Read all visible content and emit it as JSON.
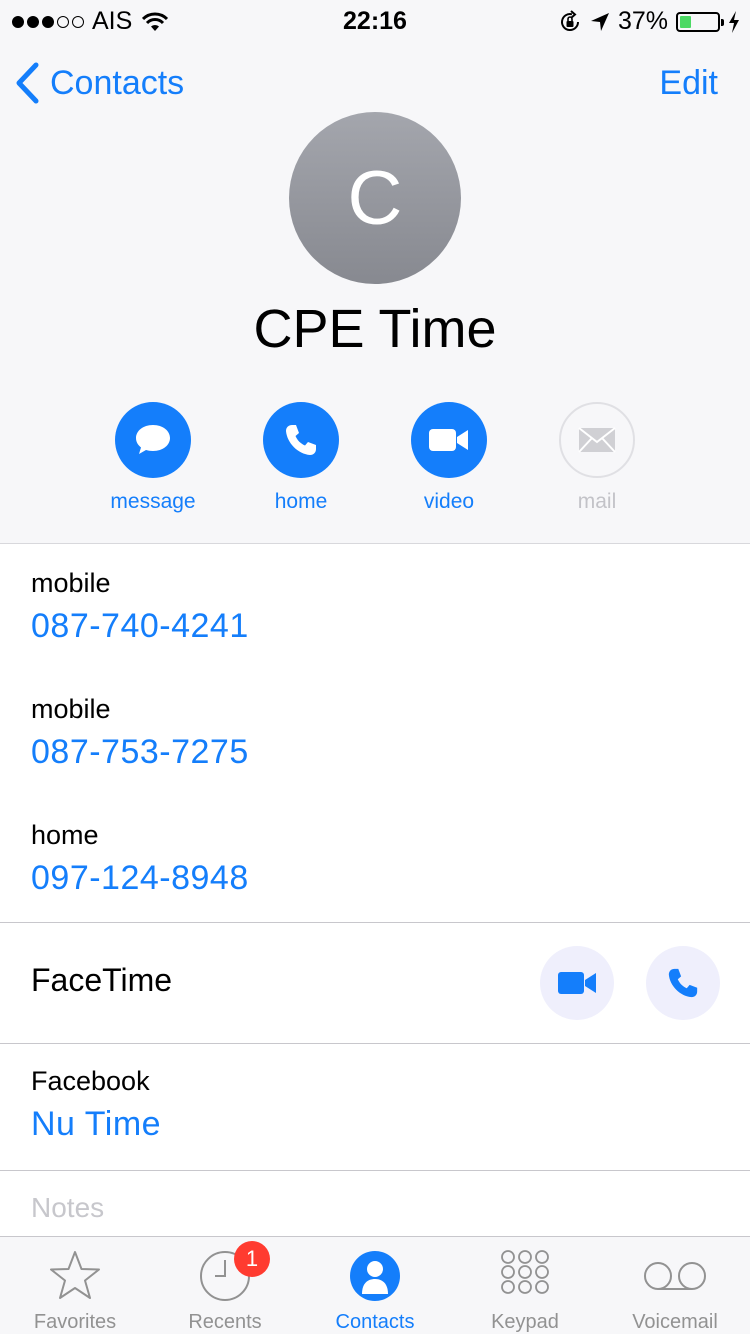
{
  "status_bar": {
    "carrier": "AIS",
    "time": "22:16",
    "battery": "37%",
    "battery_level": 0.37
  },
  "nav": {
    "back_label": "Contacts",
    "edit_label": "Edit"
  },
  "contact": {
    "initial": "C",
    "name": "CPE Time"
  },
  "actions": [
    {
      "label": "message",
      "icon": "message-bubble-icon",
      "enabled": true
    },
    {
      "label": "home",
      "icon": "phone-icon",
      "enabled": true
    },
    {
      "label": "video",
      "icon": "video-camera-icon",
      "enabled": true
    },
    {
      "label": "mail",
      "icon": "envelope-icon",
      "enabled": false
    }
  ],
  "phones": [
    {
      "label": "mobile",
      "number": "087-740-4241"
    },
    {
      "label": "mobile",
      "number": "087-753-7275"
    },
    {
      "label": "home",
      "number": "097-124-8948"
    }
  ],
  "facetime": {
    "label": "FaceTime"
  },
  "social": {
    "label": "Facebook",
    "value": "Nu Time"
  },
  "notes": {
    "placeholder": "Notes"
  },
  "tabs": [
    {
      "label": "Favorites",
      "icon": "star-icon",
      "active": false
    },
    {
      "label": "Recents",
      "icon": "clock-icon",
      "active": false,
      "badge": "1"
    },
    {
      "label": "Contacts",
      "icon": "person-icon",
      "active": true
    },
    {
      "label": "Keypad",
      "icon": "keypad-icon",
      "active": false
    },
    {
      "label": "Voicemail",
      "icon": "voicemail-icon",
      "active": false
    }
  ],
  "colors": {
    "accent": "#147efb",
    "badge": "#ff3b30",
    "battery_fill": "#4cd964"
  }
}
